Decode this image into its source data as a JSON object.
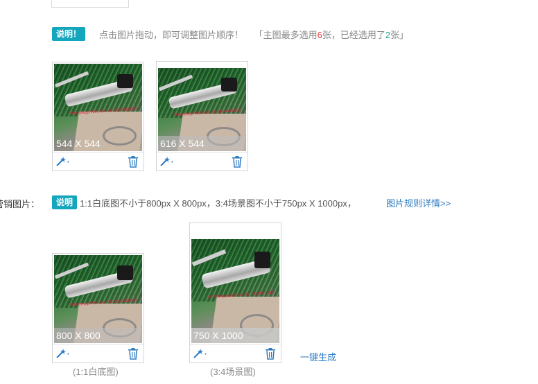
{
  "section1": {
    "badge": "说明！",
    "note_prefix": "点击图片拖动，即可调整图片顺序！",
    "note_mid1": "「主图最多选用",
    "max_count": "6",
    "note_mid2": "张，已经选用了",
    "used_count": "2",
    "note_suffix": "张」",
    "images": [
      {
        "size": "544 X 544"
      },
      {
        "size": "616 X 544"
      }
    ]
  },
  "section2": {
    "label": "营销图片：",
    "badge": "说明",
    "note": "1:1白底图不小于800px X 800px，3:4场景图不小于750px X 1000px，",
    "rules_link": "图片规则详情>>",
    "images": [
      {
        "size": "800 X 800",
        "caption": "(1:1白底图)"
      },
      {
        "size": "750 X 1000",
        "caption": "(3:4场景图)"
      }
    ],
    "generate_link": "一键生成"
  },
  "icons": {
    "edit": "magic-wand-icon",
    "delete": "trash-icon"
  },
  "colors": {
    "badge": "#14a6bd",
    "link": "#2d7bc2",
    "highlight_red": "#e3393c",
    "highlight_teal": "#1aa39a"
  }
}
